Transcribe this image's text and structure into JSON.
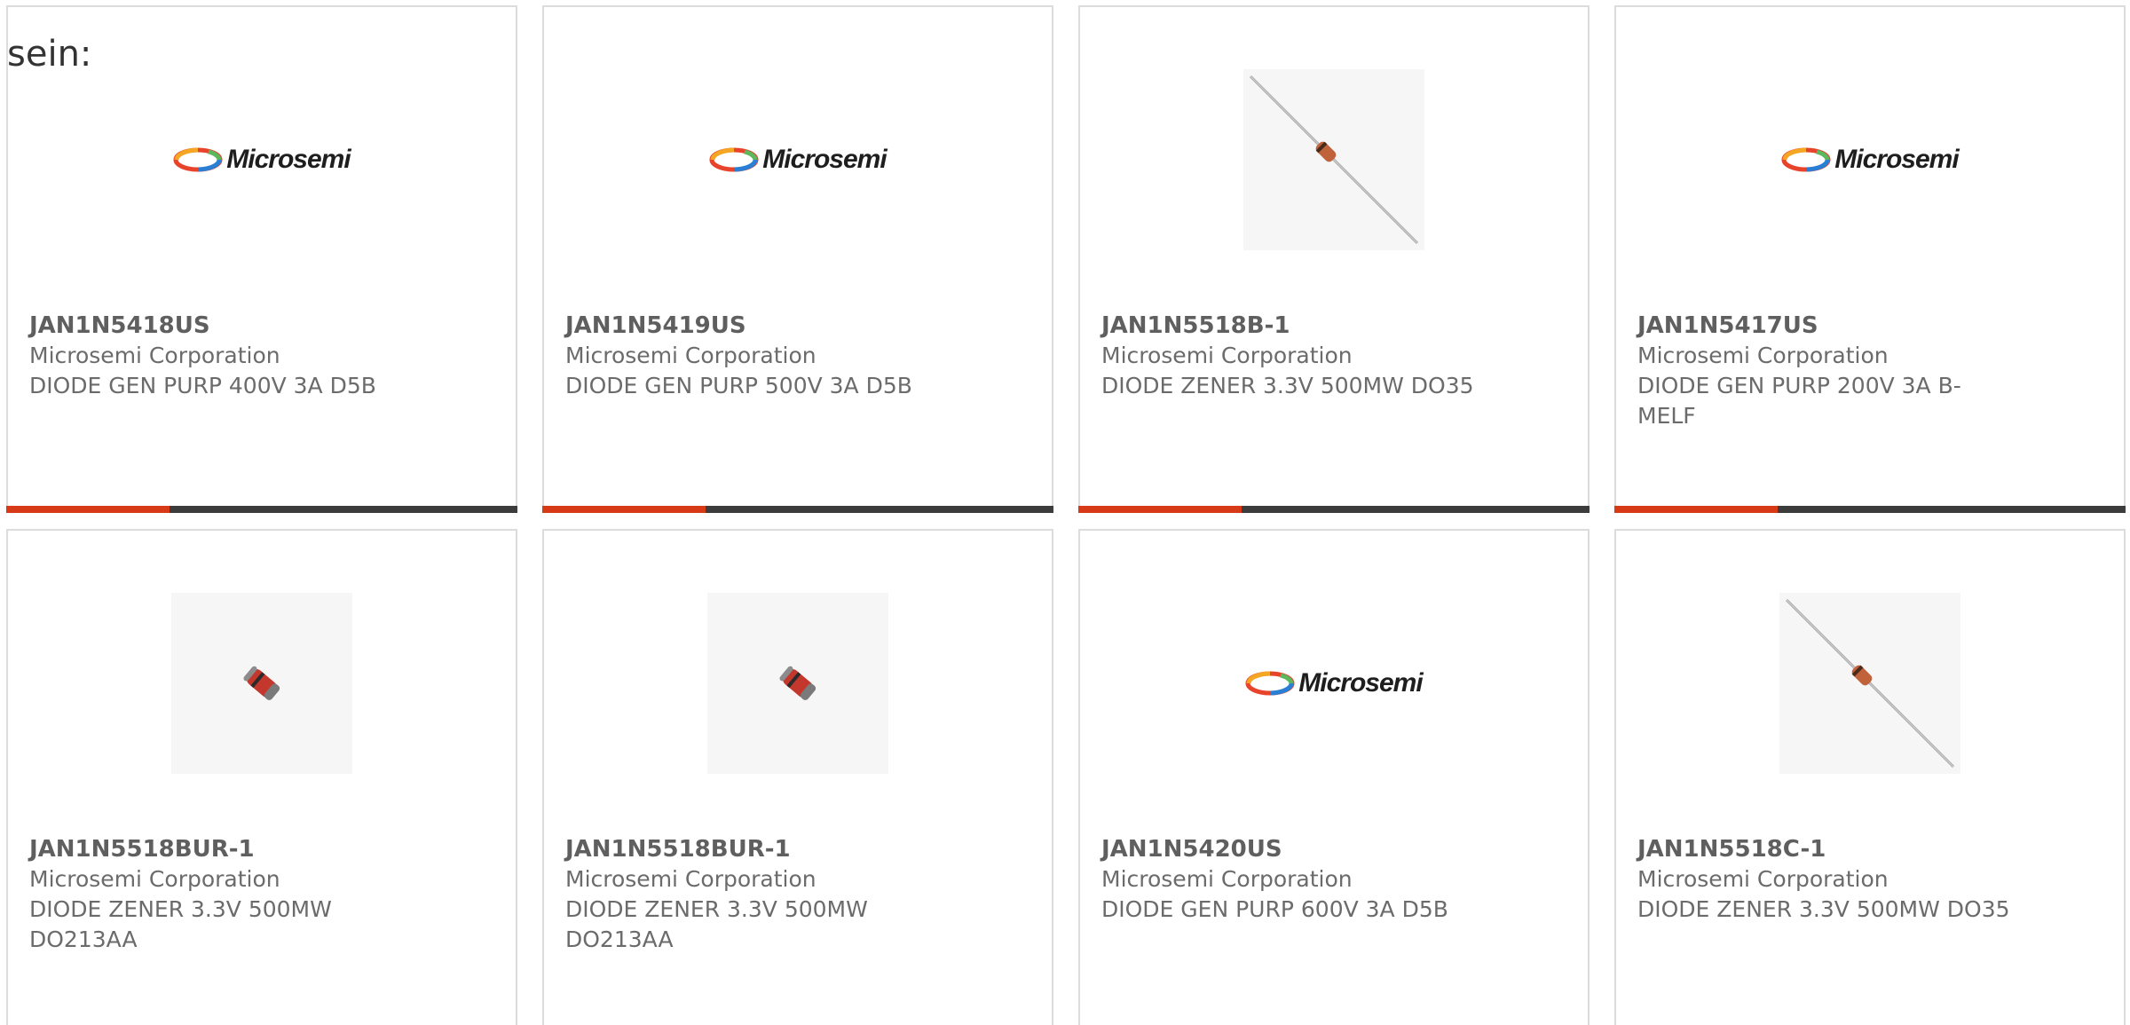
{
  "intro_text": "sein:",
  "colors": {
    "accent": "#d63a17",
    "bar_dark": "#3c3c3c",
    "border": "#dcdcdc",
    "text": "#6b6b6b"
  },
  "accent_fraction": 0.32,
  "logo_text": "Microsemi",
  "products": [
    {
      "part_number": "JAN1N5418US",
      "manufacturer": "Microsemi Corporation",
      "description": "DIODE GEN PURP 400V 3A D5B",
      "image": "microsemi-logo"
    },
    {
      "part_number": "JAN1N5419US",
      "manufacturer": "Microsemi Corporation",
      "description": "DIODE GEN PURP 500V 3A D5B",
      "image": "microsemi-logo"
    },
    {
      "part_number": "JAN1N5518B-1",
      "manufacturer": "Microsemi Corporation",
      "description": "DIODE ZENER 3.3V 500MW DO35",
      "image": "axial-diode-photo"
    },
    {
      "part_number": "JAN1N5417US",
      "manufacturer": "Microsemi Corporation",
      "description": "DIODE GEN PURP 200V 3A B-\nMELF",
      "image": "microsemi-logo"
    },
    {
      "part_number": "JAN1N5518BUR-1",
      "manufacturer": "Microsemi Corporation",
      "description": "DIODE ZENER 3.3V 500MW\nDO213AA",
      "image": "melf-diode-photo"
    },
    {
      "part_number": "JAN1N5518BUR-1",
      "manufacturer": "Microsemi Corporation",
      "description": "DIODE ZENER 3.3V 500MW\nDO213AA",
      "image": "melf-diode-photo"
    },
    {
      "part_number": "JAN1N5420US",
      "manufacturer": "Microsemi Corporation",
      "description": "DIODE GEN PURP 600V 3A D5B",
      "image": "microsemi-logo"
    },
    {
      "part_number": "JAN1N5518C-1",
      "manufacturer": "Microsemi Corporation",
      "description": "DIODE ZENER 3.3V 500MW DO35",
      "image": "axial-diode-photo"
    }
  ]
}
